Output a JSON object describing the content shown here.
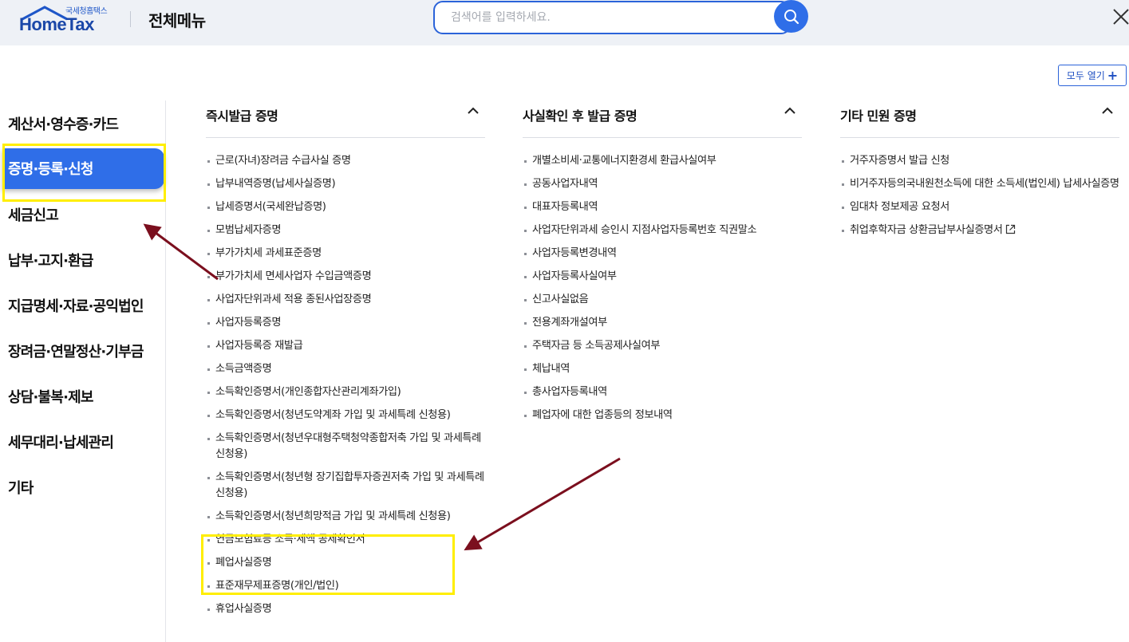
{
  "header": {
    "logo_small": "국세청홈택스",
    "logo_main": "HomeTax",
    "title": "전체메뉴",
    "search_placeholder": "검색어를 입력하세요."
  },
  "open_all_label": "모두 열기",
  "sidebar": {
    "items": [
      "계산서·영수증·카드",
      "증명·등록·신청",
      "세금신고",
      "납부·고지·환급",
      "지급명세·자료·공익법인",
      "장려금·연말정산·기부금",
      "상담·불복·제보",
      "세무대리·납세관리",
      "기타"
    ],
    "active_index": 1
  },
  "columns": [
    {
      "title": "즉시발급 증명",
      "items": [
        "근로(자녀)장려금 수급사실 증명",
        "납부내역증명(납세사실증명)",
        "납세증명서(국세완납증명)",
        "모범납세자증명",
        "부가가치세 과세표준증명",
        "부가가치세 면세사업자 수입금액증명",
        "사업자단위과세 적용 종된사업장증명",
        "사업자등록증명",
        "사업자등록증 재발급",
        "소득금액증명",
        "소득확인증명서(개인종합자산관리계좌가입)",
        "소득확인증명서(청년도약계좌 가입 및 과세특례 신청용)",
        "소득확인증명서(청년우대형주택청약종합저축 가입 및 과세특례 신청용)",
        "소득확인증명서(청년형 장기집합투자증권저축 가입 및 과세특례 신청용)",
        "소득확인증명서(청년희망적금 가입 및 과세특례 신청용)",
        "연금보험료등 소득·세액 공제확인서",
        "폐업사실증명",
        "표준재무제표증명(개인/법인)",
        "휴업사실증명"
      ]
    },
    {
      "title": "사실확인 후 발급 증명",
      "items": [
        "개별소비세·교통에너지환경세 환급사실여부",
        "공동사업자내역",
        "대표자등록내역",
        "사업자단위과세 승인시 지점사업자등록번호 직권말소",
        "사업자등록변경내역",
        "사업자등록사실여부",
        "신고사실없음",
        "전용계좌개설여부",
        "주택자금 등 소득공제사실여부",
        "체납내역",
        "총사업자등록내역",
        "폐업자에 대한 업종등의 정보내역"
      ]
    },
    {
      "title": "기타 민원 증명",
      "items": [
        "거주자증명서 발급 신청",
        "비거주자등의국내원천소득에 대한 소득세(법인세) 납세사실증명",
        "임대차 정보제공 요청서",
        "취업후학자금 상환금납부사실증명서"
      ]
    }
  ],
  "colors": {
    "accent": "#2f6ee8",
    "highlight": "#ffee00",
    "arrow": "#7b0f1e"
  }
}
